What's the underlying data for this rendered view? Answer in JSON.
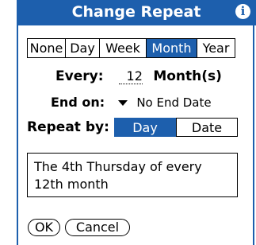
{
  "dialog": {
    "title": "Change Repeat",
    "info_icon": "info-icon",
    "accent_color": "#1d5fad"
  },
  "frequency": {
    "options": [
      "None",
      "Day",
      "Week",
      "Month",
      "Year"
    ],
    "selected": "Month"
  },
  "every": {
    "label": "Every:",
    "value": "12",
    "unit": "Month(s)"
  },
  "end_on": {
    "label": "End on:",
    "value": "No End Date"
  },
  "repeat_by": {
    "label": "Repeat by:",
    "options": [
      "Day",
      "Date"
    ],
    "selected": "Day"
  },
  "description": "The 4th Thursday of every 12th month",
  "buttons": {
    "ok": "OK",
    "cancel": "Cancel"
  }
}
